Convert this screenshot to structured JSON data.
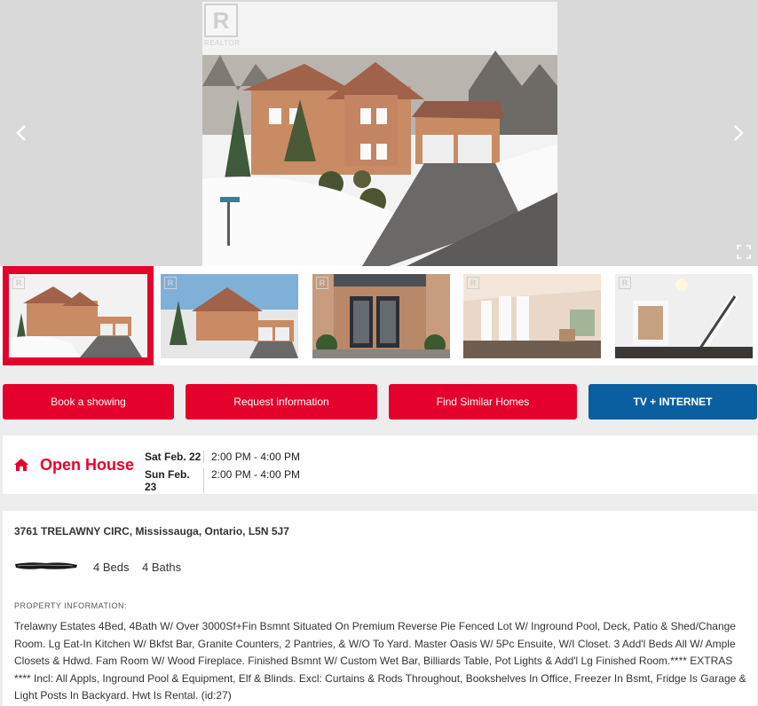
{
  "gallery": {
    "realtor_badge_letter": "R",
    "realtor_badge_text": "REALTOR",
    "prev_icon": "chevron-left-icon",
    "next_icon": "chevron-right-icon",
    "fullscreen_icon": "expand-icon"
  },
  "thumbnails": [
    {
      "scene": "exterior-aerial",
      "badge": "R",
      "selected": true
    },
    {
      "scene": "exterior-front",
      "badge": "R",
      "selected": false
    },
    {
      "scene": "front-entry",
      "badge": "R",
      "selected": false
    },
    {
      "scene": "living-room",
      "badge": "R",
      "selected": false
    },
    {
      "scene": "foyer-staircase",
      "badge": "R",
      "selected": false
    }
  ],
  "actions": {
    "book": "Book a showing",
    "request": "Request information",
    "similar": "Find Similar Homes",
    "tv": "TV + INTERNET"
  },
  "open_house": {
    "title": "Open House",
    "icon": "home-icon",
    "rows": [
      {
        "day": "Sat Feb. 22",
        "time": "2:00 PM - 4:00 PM"
      },
      {
        "day": "Sun Feb. 23",
        "time": "2:00 PM - 4:00 PM"
      }
    ]
  },
  "listing": {
    "address": "3761 TRELAWNY CIRC, Mississauga, Ontario, L5N 5J7",
    "beds": "4 Beds",
    "baths": "4 Baths",
    "section_label": "PROPERTY INFORMATION:",
    "description": "Trelawny Estates 4Bed, 4Bath W/ Over 3000Sf+Fin Bsmnt Situated On Premium Reverse Pie Fenced Lot W/ Inground Pool, Deck, Patio & Shed/Change Room. Lg Eat-In Kitchen W/ Bkfst Bar, Granite Counters, 2 Pantries, & W/O To Yard. Master Oasis W/ 5Pc Ensuite, W/I Closet. 3 Add'l Beds All W/ Ample Closets & Hdwd. Fam Room W/ Wood Fireplace. Finished Bsmnt W/ Custom Wet Bar, Billiards Table, Pot Lights & Add'l Lg Finished Room.**** EXTRAS **** Incl: All Appls, Inground Pool & Equipment, Elf & Blinds. Excl: Curtains & Rods Throughout, Bookshelves In Office, Freezer In Bsmt, Fridge Is Garage & Light Posts In Backyard. Hwt Is Rental. (id:27)"
  },
  "colors": {
    "brand_red": "#e4022d",
    "blue": "#0a5fa0",
    "gallery_bg": "#d9d9d9"
  }
}
